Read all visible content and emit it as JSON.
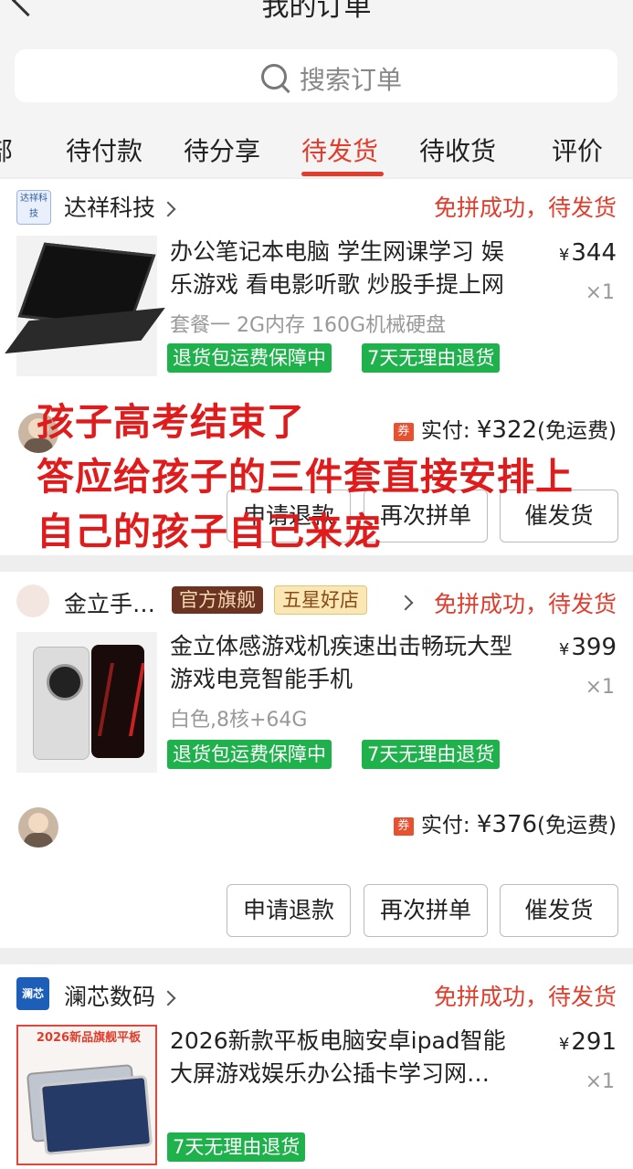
{
  "header": {
    "title": "我的订单"
  },
  "search": {
    "placeholder": "搜索订单"
  },
  "tabs": [
    {
      "label": "部"
    },
    {
      "label": "待付款"
    },
    {
      "label": "待分享"
    },
    {
      "label": "待发货"
    },
    {
      "label": "待收货"
    },
    {
      "label": "评价"
    }
  ],
  "active_tab": "待发货",
  "colors": {
    "accent": "#e23d2c",
    "tag_green": "#1fb14b",
    "overlay_red": "#e01b1b"
  },
  "orders": [
    {
      "shop_name": "达祥科技",
      "shop_logo_text": "达祥科技",
      "status": "免拼成功，待发货",
      "title": "办公笔记本电脑 学生网课学习 娱乐游戏 看电影听歌 炒股手提上网",
      "price_symbol": "¥",
      "price": "344",
      "qty": "×1",
      "spec": "套餐一 2G内存 160G机械硬盘",
      "tags": [
        "退货包运费保障中",
        "7天无理由退货"
      ],
      "coupon": "券",
      "paid_label": "实付:",
      "paid_amount": "¥322",
      "paid_note": "(免运费)",
      "buttons": [
        "申请退款",
        "再次拼单",
        "催发货"
      ]
    },
    {
      "shop_name": "金立手…",
      "badge_official": "官方旗舰",
      "badge_star": "五星好店",
      "status": "免拼成功，待发货",
      "title": "金立体感游戏机疾速出击畅玩大型游戏电竞智能手机",
      "price_symbol": "¥",
      "price": "399",
      "qty": "×1",
      "spec": "白色,8核+64G",
      "tags": [
        "退货包运费保障中",
        "7天无理由退货"
      ],
      "coupon": "券",
      "paid_label": "实付:",
      "paid_amount": "¥376",
      "paid_note": "(免运费)",
      "buttons": [
        "申请退款",
        "再次拼单",
        "催发货"
      ]
    },
    {
      "shop_name": "澜芯数码",
      "shop_logo_text": "澜芯",
      "status": "免拼成功，待发货",
      "title": "2026新款平板电脑安卓ipad智能大屏游戏娱乐办公插卡学习网…",
      "price_symbol": "¥",
      "price": "291",
      "qty": "×1",
      "thumb_header": "2026新品旗舰平板",
      "tags": [
        "7天无理由退货"
      ]
    }
  ],
  "overlay_text": [
    "孩子高考结束了",
    "答应给孩子的三件套直接安排上",
    "自己的孩子自己来宠"
  ]
}
